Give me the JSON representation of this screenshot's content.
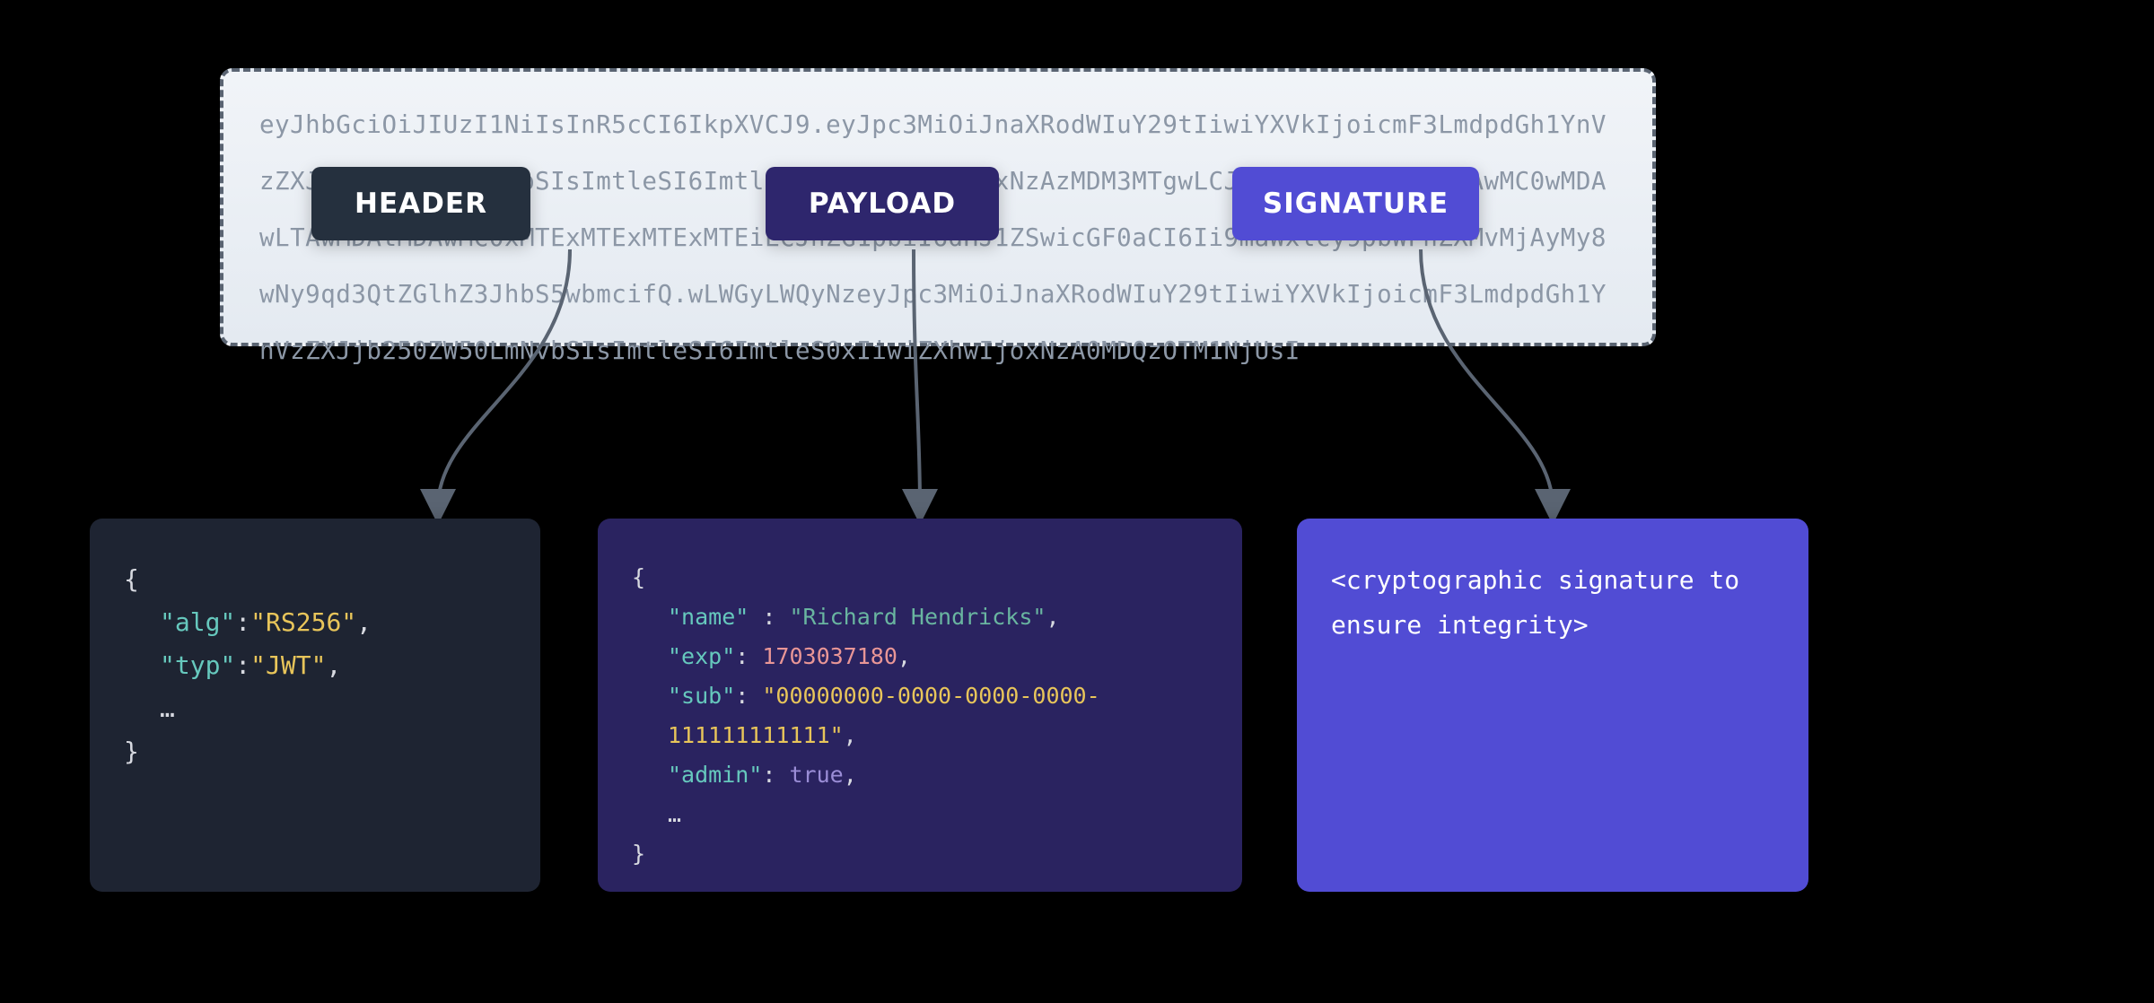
{
  "token_raw": "eyJhbGciOiJIUzI1NiIsInR5cCI6IkpXVCJ9.eyJpc3MiOiJnaXRodWIuY29tIiwiYXVkIjoicmF3LmdpdGh1YnVzZXJjb250ZW50LmNvbSIsImtleSI6ImtleS0xIiwiZXhwIjoxNzAzMDM3MTgwLCJzdWIiOiIwMDAwMDAwMC0wMDAwLTAwMDAtMDAwMC0xMTExMTExMTExMTEiLCJhZG1pbiI6dHJ1ZSwicGF0aCI6Ii9maWxlcy9pbWFnZXMvMjAyMy8wNy9qd3QtZGlhZ3JhbS5wbmcifQ.wLWGyLWQyNzeyJpc3MiOiJnaXRodWIuY29tIiwiYXVkIjoicmF3LmdpdGh1YnVzZXJjb250ZW50LmNvbSIsImtleSI6ImtleS0xIiwiZXhwIjoxNzA0MDQzOTM1NjUsI",
  "labels": {
    "header": "HEADER",
    "payload": "PAYLOAD",
    "signature": "SIGNATURE"
  },
  "header": {
    "alg_key": "\"alg\"",
    "alg_val": "\"RS256\"",
    "typ_key": "\"typ\"",
    "typ_val": "\"JWT\"",
    "ellipsis": "…"
  },
  "payload": {
    "name_key": "\"name\"",
    "name_val": "\"Richard Hendricks\"",
    "exp_key": "\"exp\"",
    "exp_val": "1703037180",
    "sub_key": "\"sub\"",
    "sub_val": "\"00000000-0000-0000-0000-111111111111\"",
    "admin_key": "\"admin\"",
    "admin_val": "true",
    "ellipsis": "…"
  },
  "signature": {
    "text": "<cryptographic signature to ensure integrity>"
  },
  "colors": {
    "header_box": "#1e2432",
    "payload_box": "#2a2360",
    "signature_box": "#514cd4",
    "token_bg": "#eef2f7"
  }
}
